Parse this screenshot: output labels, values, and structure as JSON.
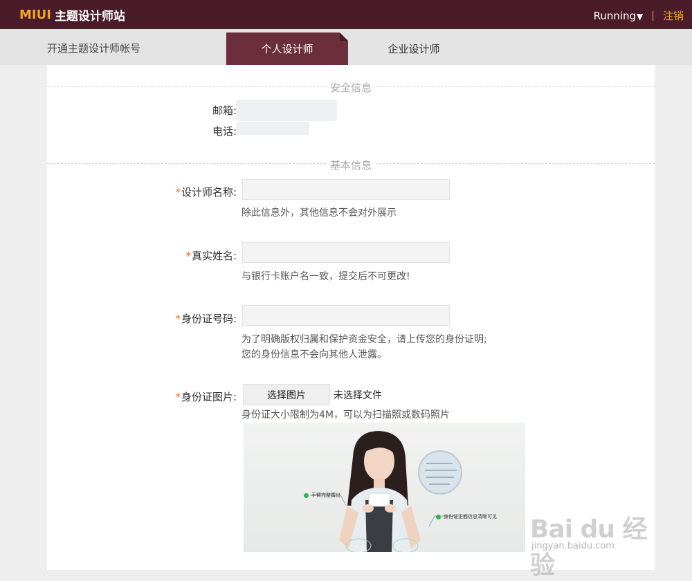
{
  "header": {
    "logo_brand": "MIUI",
    "logo_text": "主题设计师站",
    "user_name": "Running",
    "user_caret": "▼",
    "separator": "|",
    "logout": "注销",
    "colors": {
      "bar": "#4a1b29",
      "accent": "#f3a71c"
    }
  },
  "tabs": {
    "section_title": "开通主题设计师帐号",
    "items": [
      {
        "label": "个人设计师",
        "active": true
      },
      {
        "label": "企业设计师",
        "active": false
      }
    ]
  },
  "security": {
    "title": "安全信息",
    "email_label": "邮箱:",
    "phone_label": "电话:"
  },
  "basic": {
    "title": "基本信息",
    "required_mark": "*",
    "designer_name": {
      "label": "设计师名称:",
      "value": "",
      "hint": "除此信息外，其他信息不会对外展示"
    },
    "real_name": {
      "label": "真实姓名:",
      "value": "",
      "hint": "与银行卡账户名一致，提交后不可更改!"
    },
    "id_number": {
      "label": "身份证号码:",
      "value": "",
      "hint_line1": "为了明确版权归属和保护资金安全，请上传您的身份证明;",
      "hint_line2": "您的身份信息不会向其他人泄露。"
    },
    "id_photo": {
      "label": "身份证图片:",
      "button": "选择图片",
      "status": "未选择文件",
      "hint": "身份证大小限制为4M，可以为扫描照或数码照片",
      "callout_left": "手臂完整露出",
      "callout_right": "身份证正面信息清晰可见"
    }
  },
  "watermark": {
    "logo": "Bai du 经验",
    "url": "jingyan.baidu.com"
  }
}
